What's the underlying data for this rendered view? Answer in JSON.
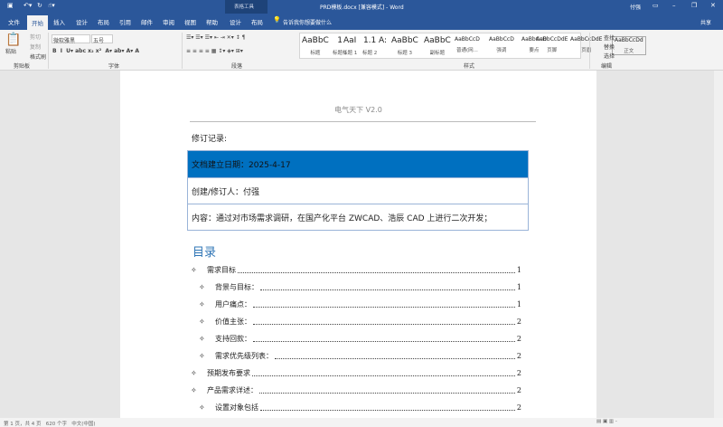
{
  "titlebar": {
    "title": "PRD模板.docx [兼容模式] - Word",
    "context": "表格工具",
    "user": "付强"
  },
  "tabs": [
    "文件",
    "开始",
    "插入",
    "设计",
    "布局",
    "引用",
    "邮件",
    "审阅",
    "视图",
    "帮助",
    "设计",
    "布局"
  ],
  "tell_me": "告诉我你想要做什么",
  "share": "共享",
  "clipboard": {
    "paste": "粘贴",
    "cut": "剪切",
    "copy": "复制",
    "format_painter": "格式刷",
    "group": "剪贴板"
  },
  "font": {
    "name": "微软雅黑",
    "size": "五号",
    "group": "字体"
  },
  "paragraph": {
    "group": "段落"
  },
  "styles": {
    "group": "样式",
    "items": [
      {
        "sample": "AaBbC",
        "label": "标题"
      },
      {
        "sample": "1",
        "label": "标题 1"
      },
      {
        "sample": "AaI",
        "label": "标题 1"
      },
      {
        "sample": "1.1",
        "label": "标题 2"
      },
      {
        "sample": "A:",
        "label": ""
      },
      {
        "sample": "AaBbC",
        "label": "标题 3"
      },
      {
        "sample": "AaBbC",
        "label": "副标题"
      },
      {
        "sample": "AaBbCcD",
        "label": "普通(网..."
      },
      {
        "sample": "AaBbCcD",
        "label": "强调"
      },
      {
        "sample": "AaBbCcD",
        "label": "要点"
      },
      {
        "sample": "AaBbCcDdE",
        "label": "页脚"
      },
      {
        "sample": "AaBbCcDdE",
        "label": "页眉"
      },
      {
        "sample": "AaBbCcDd",
        "label": "正文"
      }
    ]
  },
  "editing": {
    "find": "查找",
    "replace": "替换",
    "select": "选择",
    "group": "编辑"
  },
  "document": {
    "header": "电气天下 V2.0",
    "revision_label": "修订记录:",
    "table": [
      "文档建立日期：2025-4-17",
      "创建/修订人：付强",
      "内容：通过对市场需求调研，在国产化平台 ZWCAD、浩辰 CAD 上进行二次开发；"
    ],
    "toc_title": "目录",
    "toc": [
      {
        "text": "需求目标",
        "page": "1",
        "level": 1
      },
      {
        "text": "背景与目标：",
        "page": "1",
        "level": 2
      },
      {
        "text": "用户痛点：",
        "page": "1",
        "level": 2
      },
      {
        "text": "价值主张：",
        "page": "2",
        "level": 2
      },
      {
        "text": "支持回款：",
        "page": "2",
        "level": 2
      },
      {
        "text": "需求优先级列表：",
        "page": "2",
        "level": 2
      },
      {
        "text": "预期发布要求",
        "page": "2",
        "level": 1
      },
      {
        "text": "产品需求详述：",
        "page": "2",
        "level": 1
      },
      {
        "text": "设置对象包括",
        "page": "2",
        "level": 2
      }
    ]
  },
  "status": {
    "page": "第 1 页，共 4 页",
    "words": "620 个字",
    "lang": "中文(中国)"
  },
  "colors": {
    "brand": "#2b579a",
    "table_header": "#0070c0",
    "toc_title": "#2e74b5"
  }
}
